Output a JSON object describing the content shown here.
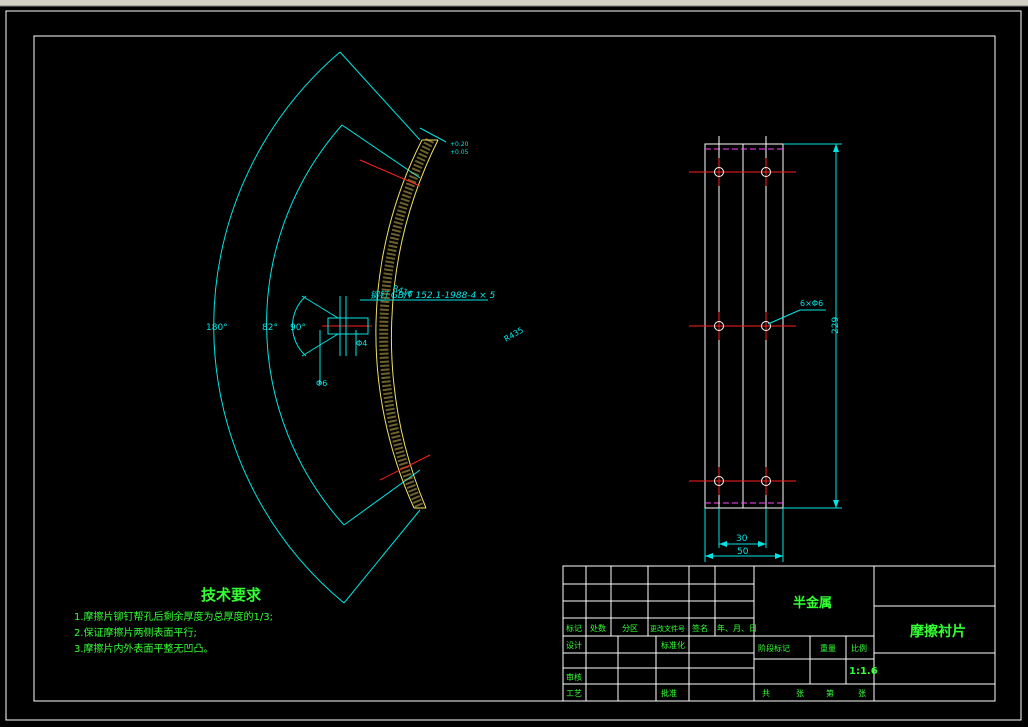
{
  "left_view": {
    "dim_180": "180°",
    "dim_82": "82°",
    "dim_90": "90°",
    "dim_phi4": "Φ4",
    "dim_phi6": "Φ6",
    "radius_r1": "R416",
    "radius_r2": "R435",
    "rivet_note": "铆钉  GB/T 152.1-1988-4 × 5",
    "tol_upper": "+0.20",
    "tol_lower": "+0.05"
  },
  "right_view": {
    "hole_note": "6×Φ6",
    "dim_229": "229",
    "dim_30": "30",
    "dim_50": "50"
  },
  "tech": {
    "title": "技术要求",
    "items": [
      "1.摩擦片铆钉帮孔后剩余厚度为总厚度的1/3;",
      "2.保证摩擦片两侧表面平行;",
      "3.摩擦片内外表面平整无凹凸。"
    ]
  },
  "title_block": {
    "material": "半金属",
    "part_name": "摩擦衬片",
    "scale": "1:1.6",
    "lbl_mark": "标记",
    "lbl_count": "处数",
    "lbl_zone": "分区",
    "lbl_docno": "更改文件号",
    "lbl_sign": "签名",
    "lbl_date": "年、月、日",
    "lbl_design": "设计",
    "lbl_std": "标准化",
    "lbl_stage": "阶段标记",
    "lbl_weight": "重量",
    "lbl_scale": "比例",
    "lbl_review": "审核",
    "lbl_craft": "工艺",
    "lbl_approve": "批准",
    "lbl_total": "共",
    "lbl_sheet": "张",
    "lbl_page": "第",
    "lbl_sheet2": "张"
  }
}
